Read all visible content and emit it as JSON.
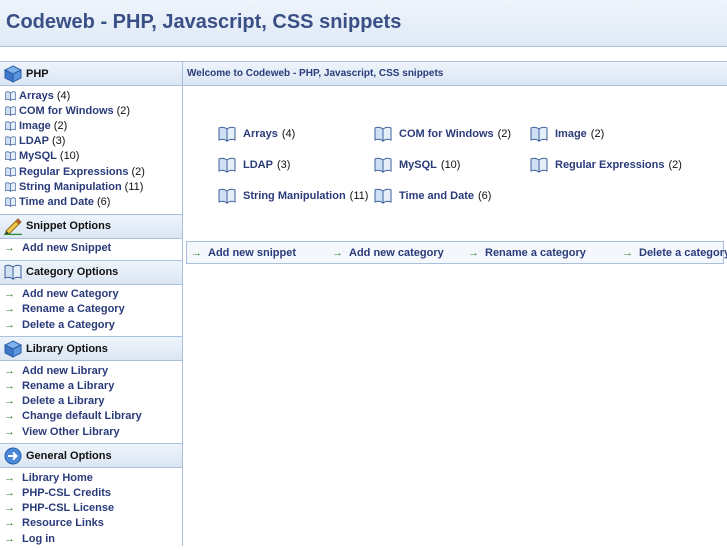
{
  "header": {
    "title": "Codeweb - PHP, Javascript, CSS snippets"
  },
  "sidebar": {
    "library": {
      "title": "PHP",
      "categories": [
        {
          "name": "Arrays",
          "count": "(4)"
        },
        {
          "name": "COM for Windows",
          "count": "(2)"
        },
        {
          "name": "Image",
          "count": "(2)"
        },
        {
          "name": "LDAP",
          "count": "(3)"
        },
        {
          "name": "MySQL",
          "count": "(10)"
        },
        {
          "name": "Regular Expressions",
          "count": "(2)"
        },
        {
          "name": "String Manipulation",
          "count": "(11)"
        },
        {
          "name": "Time and Date",
          "count": "(6)"
        }
      ]
    },
    "snippet_options": {
      "title": "Snippet Options",
      "items": [
        "Add new Snippet"
      ]
    },
    "category_options": {
      "title": "Category Options",
      "items": [
        "Add new Category",
        "Rename a Category",
        "Delete a Category"
      ]
    },
    "library_options": {
      "title": "Library Options",
      "items": [
        "Add new Library",
        "Rename a Library",
        "Delete a Library",
        "Change default Library",
        "View Other Library"
      ]
    },
    "general_options": {
      "title": "General Options",
      "items": [
        "Library Home",
        "PHP-CSL Credits",
        "PHP-CSL License",
        "Resource Links",
        "Log in"
      ]
    }
  },
  "main": {
    "title": "Welcome to Codeweb - PHP, Javascript, CSS snippets",
    "categories": [
      {
        "name": "Arrays",
        "count": "(4)"
      },
      {
        "name": "COM for Windows",
        "count": "(2)"
      },
      {
        "name": "Image",
        "count": "(2)"
      },
      {
        "name": "LDAP",
        "count": "(3)"
      },
      {
        "name": "MySQL",
        "count": "(10)"
      },
      {
        "name": "Regular Expressions",
        "count": "(2)"
      },
      {
        "name": "String Manipulation",
        "count": "(11)"
      },
      {
        "name": "Time and Date",
        "count": "(6)"
      }
    ],
    "actions": [
      "Add new snippet",
      "Add new category",
      "Rename a category",
      "Delete a category"
    ]
  },
  "icons": {
    "library": "cube-icon",
    "snippet": "pencil-icon",
    "category": "book-icon",
    "general": "arrow-circle-icon",
    "link_arrow": "green-arrow-icon"
  },
  "colors": {
    "accent": "#2a3b7a",
    "header_bg": "#dfe9f6",
    "border": "#a9bfdc",
    "arrow": "#2d8a2d"
  }
}
